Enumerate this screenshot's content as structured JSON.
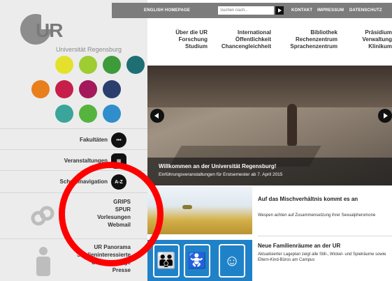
{
  "topbar": {
    "english_homepage": "ENGLISH HOMEPAGE",
    "search_placeholder": "Suchen nach...",
    "kontakt": "KONTAKT",
    "impressum": "IMPRESSUM",
    "datenschutz": "DATENSCHUTZ"
  },
  "logo": {
    "letters": "UR",
    "name": "Universität Regensburg"
  },
  "dots_colors": [
    "#e3e12c",
    "#9ecc33",
    "#3e9b3a",
    "#1e6f73",
    "#e77f1c",
    "#c71f4a",
    "#a3195b",
    "#2b3f6e",
    "#3aa59a",
    "#56b33e",
    "#2f8ecb"
  ],
  "nav": [
    [
      "Über die UR",
      "Forschung",
      "Studium"
    ],
    [
      "International",
      "Öffentlichkeit",
      "Chancengleichheit"
    ],
    [
      "Bibliothek",
      "Rechenzentrum",
      "Sprachenzentrum"
    ],
    [
      "Präsidium",
      "Verwaltung",
      "Klinikum"
    ]
  ],
  "sidebar": {
    "fakultaeten": "Fakultäten",
    "veranstaltungen": "Veranstaltungen",
    "schnellnavigation": "Schnellnavigation",
    "az": "A-Z",
    "quick_links": [
      "GRIPS",
      "SPUR",
      "Vorlesungen",
      "Webmail"
    ],
    "panorama_links": [
      "UR Panorama",
      "Studieninteressierte",
      "Uniangehörige",
      "Presse"
    ]
  },
  "hero": {
    "title": "Willkommen an der Universität Regensburg!",
    "subtitle": "Einführungsveranstaltungen für Erstsemester ab 7. April 2015"
  },
  "news": [
    {
      "title": "Auf das Mischverhältnis kommt es an",
      "text": "Wespen achten auf Zusammensetzung ihrer Sexualpheromone"
    },
    {
      "title": "Neue Familienräume an der UR",
      "text": "Aktualisierter Lageplan zeigt alle Still-, Wickel- und Spielräume sowie Eltern-Kind-Büros am Campus"
    }
  ],
  "annotation_color": "#ff0000"
}
